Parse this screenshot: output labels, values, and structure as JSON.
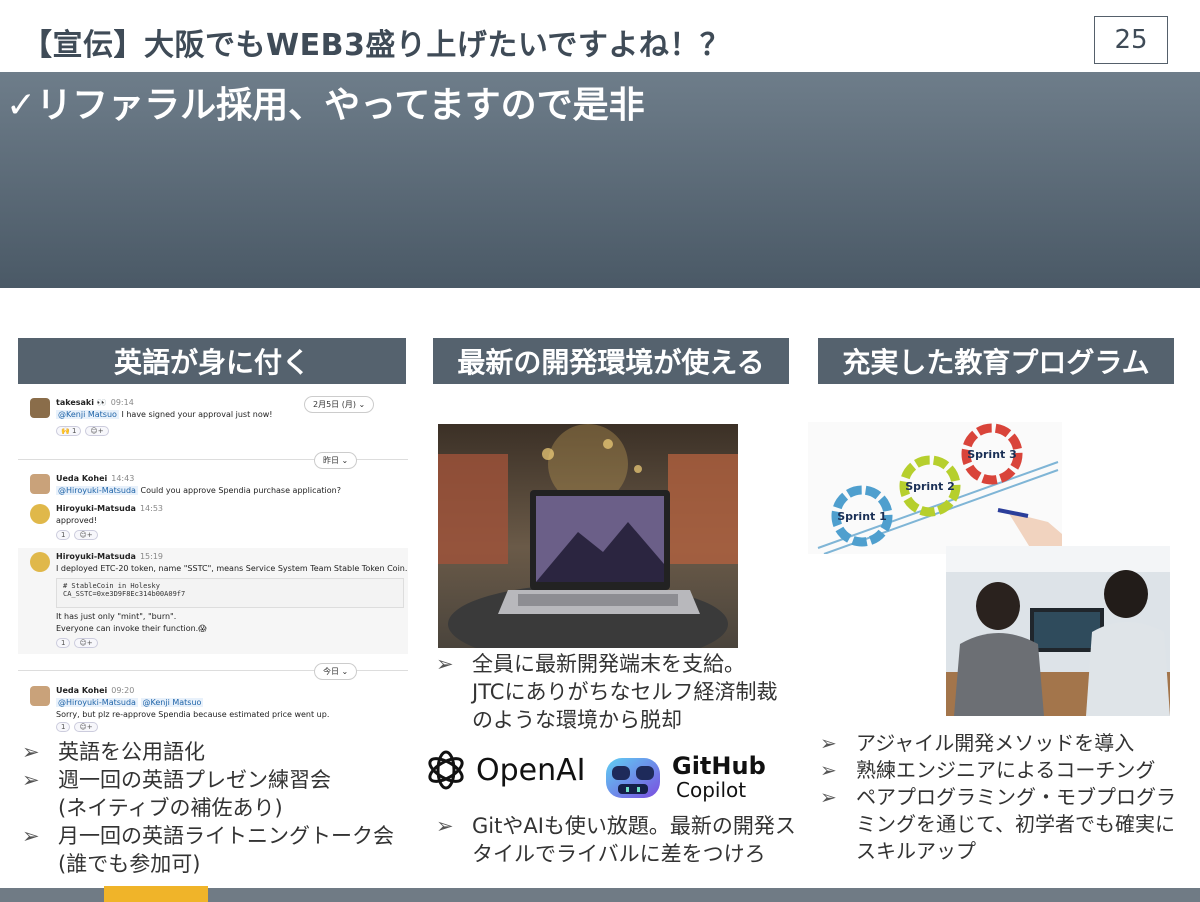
{
  "header": {
    "title": "【宣伝】大阪でもWEB3盛り上げたいですよね！？",
    "page_number": "25"
  },
  "banner": {
    "text": "✓リファラル採用、やってますので是非"
  },
  "columns": [
    {
      "heading": "英語が身に付く",
      "bullets": [
        "英語を公用語化",
        "週一回の英語プレゼン練習会\n(ネイティブの補佐あり)",
        "月一回の英語ライトニングトーク会\n(誰でも参加可)"
      ]
    },
    {
      "heading": "最新の開発環境が使える",
      "bullets_top": [
        "全員に最新開発端末を支給。\nJTCにありがちなセルフ経済制裁のような環境から脱却"
      ],
      "logos": [
        "OpenAI",
        "GitHub",
        "Copilot"
      ],
      "bullets_bottom": [
        "GitやAIも使い放題。最新の開発スタイルでライバルに差をつけろ"
      ]
    },
    {
      "heading": "充実した教育プログラム",
      "sprint_labels": [
        "Sprint 1",
        "Sprint 2",
        "Sprint 3"
      ],
      "bullets": [
        "アジャイル開発メソッドを導入",
        "熟練エンジニアによるコーチング",
        "ペアプログラミング・モブプログラミングを通じて、初学者でも確実にスキルアップ"
      ]
    }
  ],
  "slack": {
    "dates": [
      "2月5日 (月)",
      "昨日",
      "今日"
    ],
    "messages": [
      {
        "name": "takesaki 👀",
        "time": "09:14",
        "mention": "@Kenji Matsuo",
        "text": " I have signed your approval just now!",
        "reaction": "🙌 1"
      },
      {
        "name": "Ueda Kohei",
        "time": "14:43",
        "mention": "@Hiroyuki-Matsuda",
        "text": " Could you approve Spendia purchase application?",
        "reaction": ""
      },
      {
        "name": "Hiroyuki-Matsuda",
        "time": "14:53",
        "mention": "",
        "text": "approved!",
        "reaction": "1"
      },
      {
        "name": "Hiroyuki-Matsuda",
        "time": "15:19",
        "mention": "",
        "text": "I deployed ETC-20 token, name \"SSTC\", means Service System Team Stable Token Coin.",
        "reaction": "1"
      },
      {
        "name": "Ueda Kohei",
        "time": "09:20",
        "mention": "@Hiroyuki-Matsuda",
        "mention2": "@Kenji Matsuo",
        "text": "Sorry, but plz re-approve Spendia because estimated price went up.",
        "reaction": "1"
      }
    ],
    "code_lines": [
      "# StableCoin in Holesky",
      "CA_SSTC=0xe3D9F8Ec314b00A09f7"
    ],
    "followup_lines": [
      "It has just only \"mint\", \"burn\".",
      "Everyone can invoke their function.😱"
    ]
  },
  "colors": {
    "title": "#3f4b57",
    "banner": "#55626e",
    "column_header": "#55626e",
    "footer": "#707b85",
    "footer_accent": "#f0b429"
  }
}
